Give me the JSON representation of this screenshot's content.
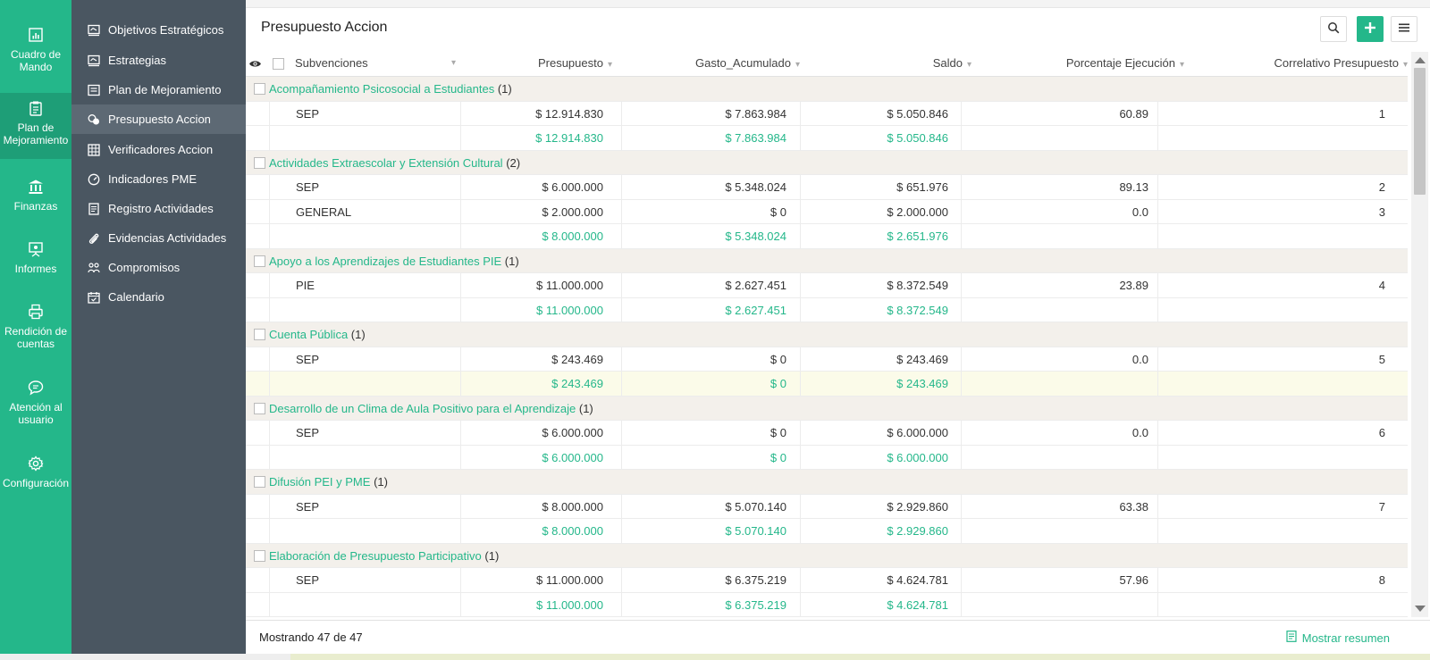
{
  "rail": {
    "items": [
      {
        "label": "Cuadro de Mando",
        "icon": "chart-icon"
      },
      {
        "label": "Plan de Mejoramiento",
        "icon": "clipboard-icon"
      },
      {
        "label": "Finanzas",
        "icon": "bank-icon"
      },
      {
        "label": "Informes",
        "icon": "presentation-icon"
      },
      {
        "label": "Rendición de cuentas",
        "icon": "printer-icon"
      },
      {
        "label": "Atención al usuario",
        "icon": "chat-icon"
      },
      {
        "label": "Configuración",
        "icon": "gear-icon"
      }
    ]
  },
  "nav": {
    "items": [
      {
        "label": "Objetivos Estratégicos",
        "icon": "board-icon"
      },
      {
        "label": "Estrategias",
        "icon": "board-icon"
      },
      {
        "label": "Plan de Mejoramiento",
        "icon": "list-icon"
      },
      {
        "label": "Presupuesto Accion",
        "icon": "coins-icon"
      },
      {
        "label": "Verificadores Accion",
        "icon": "grid-icon"
      },
      {
        "label": "Indicadores PME",
        "icon": "gauge-icon"
      },
      {
        "label": "Registro Actividades",
        "icon": "document-icon"
      },
      {
        "label": "Evidencias Actividades",
        "icon": "paperclip-icon"
      },
      {
        "label": "Compromisos",
        "icon": "people-icon"
      },
      {
        "label": "Calendario",
        "icon": "calendar-icon"
      }
    ]
  },
  "page": {
    "title": "Presupuesto Accion"
  },
  "table": {
    "columns": {
      "subvenciones": "Subvenciones",
      "presupuesto": "Presupuesto",
      "gasto": "Gasto_Acumulado",
      "saldo": "Saldo",
      "porcentaje": "Porcentaje Ejecución",
      "correlativo": "Correlativo Presupuesto"
    },
    "groups": [
      {
        "name": "Acompañamiento Psicosocial a Estudiantes",
        "count": "(1)",
        "rows": [
          {
            "sub": "SEP",
            "presupuesto": "$ 12.914.830",
            "gasto": "$ 7.863.984",
            "saldo": "$ 5.050.846",
            "porcentaje": "60.89",
            "correlativo": "1"
          }
        ],
        "total": {
          "presupuesto": "$ 12.914.830",
          "gasto": "$ 7.863.984",
          "saldo": "$ 5.050.846"
        }
      },
      {
        "name": "Actividades Extraescolar y Extensión Cultural",
        "count": "(2)",
        "rows": [
          {
            "sub": "SEP",
            "presupuesto": "$ 6.000.000",
            "gasto": "$ 5.348.024",
            "saldo": "$ 651.976",
            "porcentaje": "89.13",
            "correlativo": "2"
          },
          {
            "sub": "GENERAL",
            "presupuesto": "$ 2.000.000",
            "gasto": "$ 0",
            "saldo": "$ 2.000.000",
            "porcentaje": "0.0",
            "correlativo": "3"
          }
        ],
        "total": {
          "presupuesto": "$ 8.000.000",
          "gasto": "$ 5.348.024",
          "saldo": "$ 2.651.976"
        }
      },
      {
        "name": "Apoyo a los Aprendizajes de Estudiantes PIE",
        "count": "(1)",
        "rows": [
          {
            "sub": "PIE",
            "presupuesto": "$ 11.000.000",
            "gasto": "$ 2.627.451",
            "saldo": "$ 8.372.549",
            "porcentaje": "23.89",
            "correlativo": "4"
          }
        ],
        "total": {
          "presupuesto": "$ 11.000.000",
          "gasto": "$ 2.627.451",
          "saldo": "$ 8.372.549"
        }
      },
      {
        "name": "Cuenta Pública",
        "count": "(1)",
        "rows": [
          {
            "sub": "SEP",
            "presupuesto": "$ 243.469",
            "gasto": "$ 0",
            "saldo": "$ 243.469",
            "porcentaje": "0.0",
            "correlativo": "5"
          }
        ],
        "total": {
          "presupuesto": "$ 243.469",
          "gasto": "$ 0",
          "saldo": "$ 243.469"
        },
        "highlight_total": true
      },
      {
        "name": "Desarrollo de un Clima de Aula Positivo para el Aprendizaje",
        "count": "(1)",
        "rows": [
          {
            "sub": "SEP",
            "presupuesto": "$ 6.000.000",
            "gasto": "$ 0",
            "saldo": "$ 6.000.000",
            "porcentaje": "0.0",
            "correlativo": "6"
          }
        ],
        "total": {
          "presupuesto": "$ 6.000.000",
          "gasto": "$ 0",
          "saldo": "$ 6.000.000"
        }
      },
      {
        "name": "Difusión PEI y PME",
        "count": "(1)",
        "rows": [
          {
            "sub": "SEP",
            "presupuesto": "$ 8.000.000",
            "gasto": "$ 5.070.140",
            "saldo": "$ 2.929.860",
            "porcentaje": "63.38",
            "correlativo": "7"
          }
        ],
        "total": {
          "presupuesto": "$ 8.000.000",
          "gasto": "$ 5.070.140",
          "saldo": "$ 2.929.860"
        }
      },
      {
        "name": "Elaboración de Presupuesto Participativo",
        "count": "(1)",
        "rows": [
          {
            "sub": "SEP",
            "presupuesto": "$ 11.000.000",
            "gasto": "$ 6.375.219",
            "saldo": "$ 4.624.781",
            "porcentaje": "57.96",
            "correlativo": "8"
          }
        ],
        "total": {
          "presupuesto": "$ 11.000.000",
          "gasto": "$ 6.375.219",
          "saldo": "$ 4.624.781"
        }
      }
    ]
  },
  "footer": {
    "count": "Mostrando 47 de 47",
    "summary_link": "Mostrar resumen"
  },
  "colors": {
    "accent": "#24b78a",
    "nav_bg": "#4a5661",
    "group_bg": "#f3f0eb"
  }
}
